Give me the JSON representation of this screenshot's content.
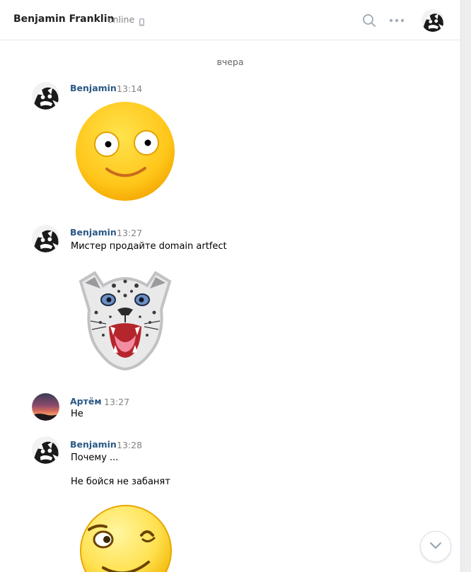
{
  "header": {
    "name": "Benjamin Franklin",
    "status": "online",
    "icons": {
      "device": "mobile-phone-icon",
      "search": "search-icon",
      "more": "more-dots-icon"
    }
  },
  "chat": {
    "date_separator": "вчера",
    "messages": [
      {
        "author": "Benjamin",
        "time": "13:14",
        "text": [],
        "sticker": "smiling-face-sticker"
      },
      {
        "author": "Benjamin",
        "time": "13:27",
        "text": [
          "Мистер продайте domain artfect"
        ],
        "sticker": "snow-leopard-sticker"
      },
      {
        "author": "Артём",
        "time": "13:27",
        "text": [
          "Не"
        ]
      },
      {
        "author": "Benjamin",
        "time": "13:28",
        "text": [
          "Почему ...",
          "Не бойся не забанят"
        ],
        "sticker": "winking-face-sticker"
      }
    ]
  },
  "colors": {
    "author_link": "#2a5885",
    "time": "#828282",
    "border": "#e7e8ec"
  }
}
